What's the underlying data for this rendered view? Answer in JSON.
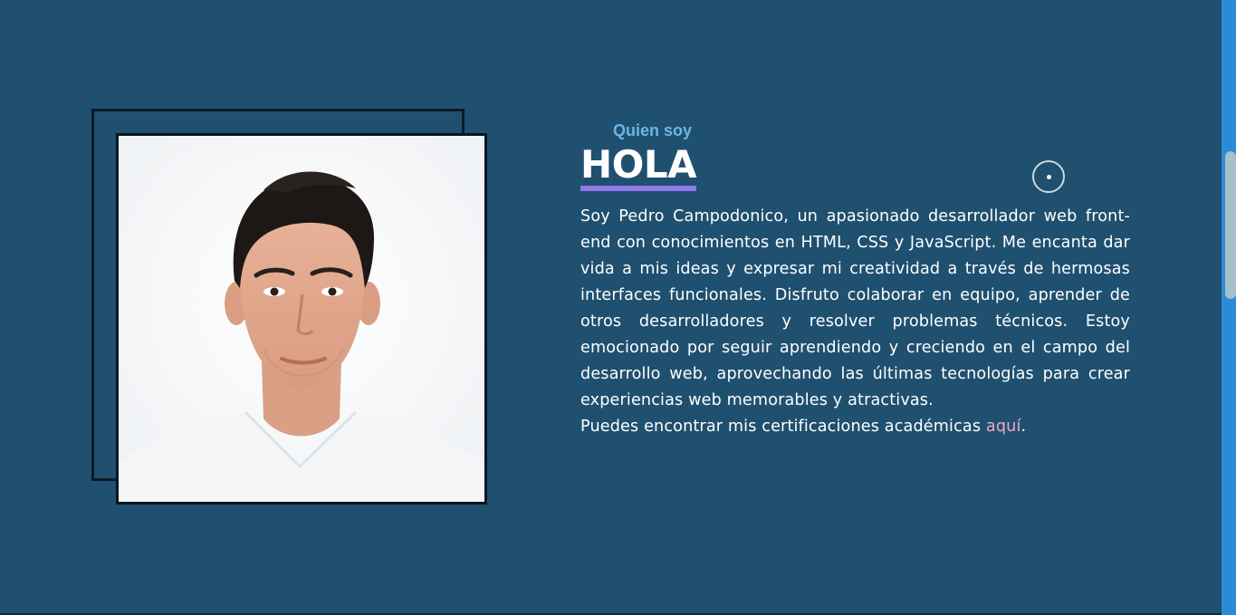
{
  "about": {
    "eyebrow": "Quien soy",
    "heading": "HOLA",
    "bio": "Soy Pedro Campodonico, un apasionado desarrollador web front-end con conocimientos en HTML, CSS y JavaScript. Me encanta dar vida a mis ideas y expresar mi creatividad a través de hermosas interfaces funcionales. Disfruto colaborar en equipo, aprender de otros desarrolladores y resolver problemas técnicos. Estoy emocionado por seguir aprendiendo y creciendo en el campo del desarrollo web, aprovechando las últimas tecnologías para crear experiencias web memorables y atractivas.",
    "certs_prefix": "Puedes encontrar mis certificaciones académicas ",
    "certs_link": "aquí",
    "certs_suffix": "."
  },
  "colors": {
    "background": "#1f5070",
    "eyebrow": "#6cb6e6",
    "heading_underline": "#8f78e8",
    "link": "#f2a6c4",
    "scrollbar": "#2c8bd6"
  },
  "icons": {
    "cursor": "cursor-ring-icon",
    "profile": "profile-photo"
  }
}
